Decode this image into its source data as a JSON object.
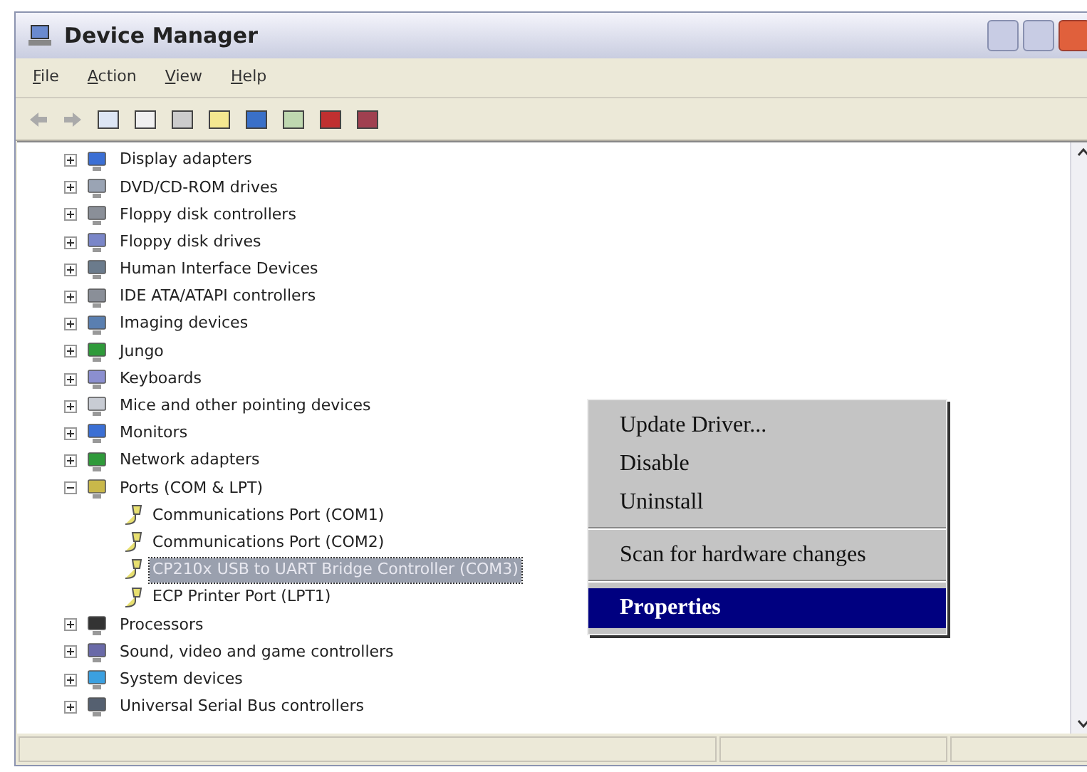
{
  "window": {
    "title": "Device Manager"
  },
  "menu_bar": [
    "File",
    "Action",
    "View",
    "Help"
  ],
  "tree": [
    {
      "label": "Display adapters",
      "expanded": false,
      "selected": false
    },
    {
      "label": "DVD/CD-ROM drives",
      "expanded": false,
      "selected": false
    },
    {
      "label": "Floppy disk controllers",
      "expanded": false,
      "selected": false
    },
    {
      "label": "Floppy disk drives",
      "expanded": false,
      "selected": false
    },
    {
      "label": "Human Interface Devices",
      "expanded": false,
      "selected": false
    },
    {
      "label": "IDE ATA/ATAPI controllers",
      "expanded": false,
      "selected": false
    },
    {
      "label": "Imaging devices",
      "expanded": false,
      "selected": false
    },
    {
      "label": "Jungo",
      "expanded": false,
      "selected": false
    },
    {
      "label": "Keyboards",
      "expanded": false,
      "selected": false
    },
    {
      "label": "Mice and other pointing devices",
      "expanded": false,
      "selected": false
    },
    {
      "label": "Monitors",
      "expanded": false,
      "selected": false
    },
    {
      "label": "Network adapters",
      "expanded": false,
      "selected": false
    },
    {
      "label": "Ports (COM & LPT)",
      "expanded": true,
      "selected": false,
      "children": [
        {
          "label": "Communications Port (COM1)",
          "selected": false
        },
        {
          "label": "Communications Port (COM2)",
          "selected": false
        },
        {
          "label": "CP210x USB to UART Bridge Controller (COM3)",
          "selected": true
        },
        {
          "label": "ECP Printer Port (LPT1)",
          "selected": false
        }
      ]
    },
    {
      "label": "Processors",
      "expanded": false,
      "selected": false
    },
    {
      "label": "Sound, video and game controllers",
      "expanded": false,
      "selected": false
    },
    {
      "label": "System devices",
      "expanded": false,
      "selected": false
    },
    {
      "label": "Universal Serial Bus controllers",
      "expanded": false,
      "selected": false
    }
  ],
  "context_menu": [
    {
      "kind": "item",
      "label": "Update Driver...",
      "selected": false
    },
    {
      "kind": "item",
      "label": "Disable",
      "selected": false
    },
    {
      "kind": "item",
      "label": "Uninstall",
      "selected": false
    },
    {
      "kind": "separator"
    },
    {
      "kind": "item",
      "label": "Scan for hardware changes",
      "selected": false
    },
    {
      "kind": "separator"
    },
    {
      "kind": "item",
      "label": "Properties",
      "selected": true
    }
  ]
}
